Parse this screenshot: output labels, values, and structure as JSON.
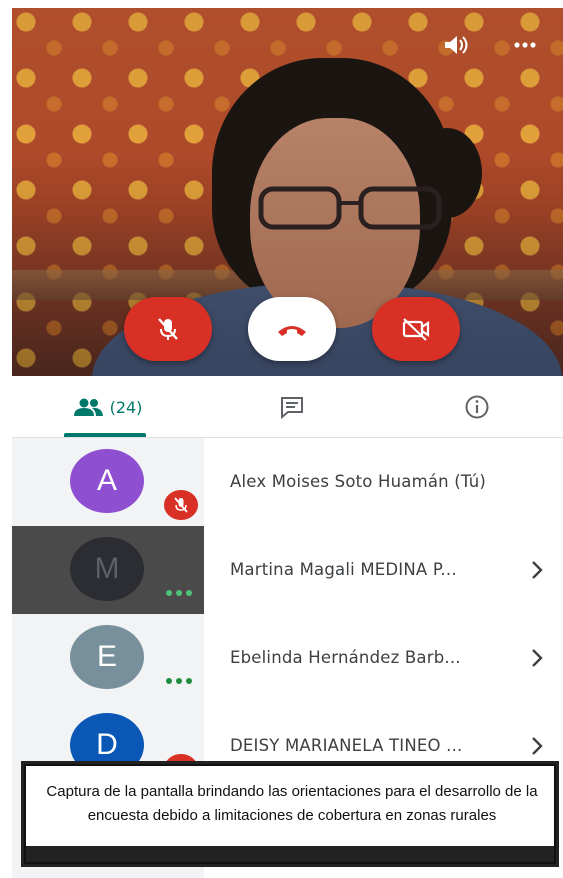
{
  "participants_tab": {
    "count_label": "(24)"
  },
  "participants": [
    {
      "initial": "A",
      "name": "Alex Moises Soto Huamán (Tú)",
      "status": "muted"
    },
    {
      "initial": "M",
      "name": "Martina Magali MEDINA P...",
      "status": "more"
    },
    {
      "initial": "E",
      "name": "Ebelinda Hernández Barb...",
      "status": "more"
    },
    {
      "initial": "D",
      "name": "DEISY MARIANELA TINEO ...",
      "status": "muted"
    }
  ],
  "caption": {
    "text": "Captura de la pantalla brindando las orientaciones para el desarrollo de la encuesta debido a limitaciones de cobertura en zonas rurales"
  },
  "colors": {
    "accent": "#00796b",
    "danger": "#d93025",
    "avatar_a": "#8e4fd1",
    "avatar_m": "#2b2d33",
    "avatar_e": "#78909c",
    "avatar_d": "#0b57b5"
  },
  "icons": {
    "top_bar": [
      "speaker-icon",
      "more-vert-icon"
    ],
    "call_controls": [
      "mic-off-icon",
      "call-end-icon",
      "videocam-off-icon"
    ],
    "tabs": [
      "people-icon",
      "chat-icon",
      "info-icon"
    ]
  }
}
